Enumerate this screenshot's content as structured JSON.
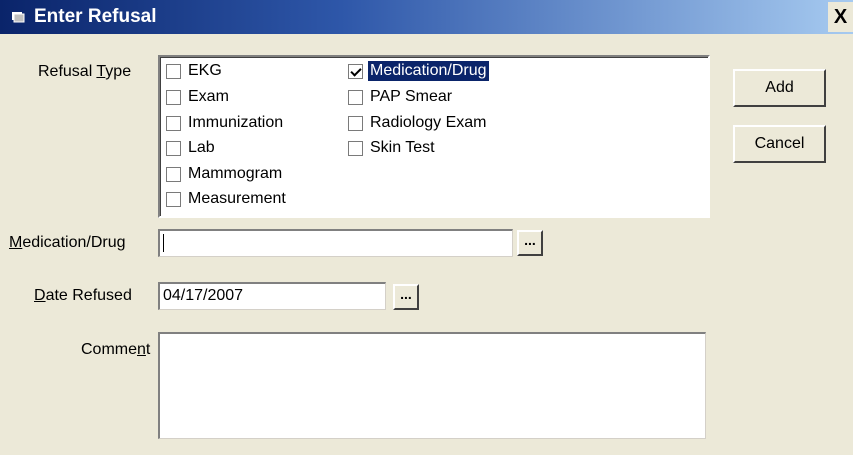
{
  "window": {
    "title": "Enter Refusal",
    "close_label": "X",
    "icon": "app-icon",
    "title_color": "#0a246a"
  },
  "refusal_type": {
    "label_before": "Refusal ",
    "label_accel": "T",
    "label_after": "ype",
    "options": [
      {
        "label": "EKG",
        "checked": false
      },
      {
        "label": "Exam",
        "checked": false
      },
      {
        "label": "Immunization",
        "checked": false
      },
      {
        "label": "Lab",
        "checked": false
      },
      {
        "label": "Mammogram",
        "checked": false
      },
      {
        "label": "Measurement",
        "checked": false
      },
      {
        "label": "Medication/Drug",
        "checked": true,
        "selected": true
      },
      {
        "label": "PAP Smear",
        "checked": false
      },
      {
        "label": "Radiology Exam",
        "checked": false
      },
      {
        "label": "Skin Test",
        "checked": false
      }
    ]
  },
  "medication": {
    "label_accel": "M",
    "label_after": "edication/Drug",
    "value": "",
    "lookup_label": "..."
  },
  "date_refused": {
    "label_accel": "D",
    "label_after": "ate Refused",
    "value": "04/17/2007",
    "picker_label": "..."
  },
  "comment": {
    "label_before": "Comme",
    "label_accel": "n",
    "label_after": "t",
    "value": ""
  },
  "buttons": {
    "add": "Add",
    "cancel": "Cancel"
  }
}
